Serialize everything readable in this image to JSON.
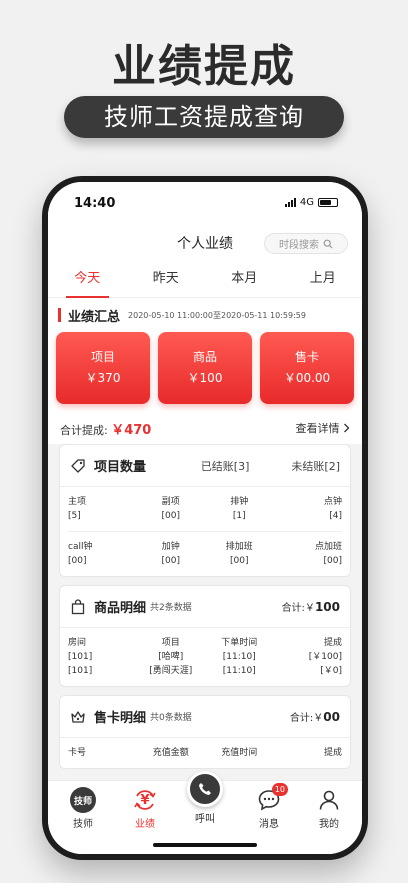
{
  "promo": {
    "title": "业绩提成",
    "subtitle": "技师工资提成查询"
  },
  "status": {
    "time": "14:40",
    "network": "4G"
  },
  "nav": {
    "title": "个人业绩",
    "search_label": "时段搜索"
  },
  "tabs": [
    {
      "label": "今天",
      "active": true
    },
    {
      "label": "昨天",
      "active": false
    },
    {
      "label": "本月",
      "active": false
    },
    {
      "label": "上月",
      "active": false
    }
  ],
  "summary": {
    "title": "业绩汇总",
    "range": "2020-05-10 11:00:00至2020-05-11 10:59:59",
    "cards": [
      {
        "label": "项目",
        "value": "￥370"
      },
      {
        "label": "商品",
        "value": "￥100"
      },
      {
        "label": "售卡",
        "value": "￥00.00"
      }
    ],
    "total_label": "合计提成:",
    "total_value": "￥470",
    "detail_link": "查看详情"
  },
  "project_panel": {
    "title": "项目数量",
    "settled": "已结账[3]",
    "unsettled": "未结账[2]",
    "row1": {
      "headers": [
        "主项",
        "副项",
        "排钟",
        "点钟"
      ],
      "values": [
        "[5]",
        "[00]",
        "[1]",
        "[4]"
      ]
    },
    "row2": {
      "headers": [
        "call钟",
        "加钟",
        "排加班",
        "点加班"
      ],
      "values": [
        "[00]",
        "[00]",
        "[00]",
        "[00]"
      ]
    }
  },
  "goods_panel": {
    "title": "商品明细",
    "sub": "共2条数据",
    "total_label": "合计:￥",
    "total_value": "100",
    "columns": [
      "房间",
      "项目",
      "下单时间",
      "提成"
    ],
    "rows": [
      [
        "[101]",
        "[哈啤]",
        "[11:10]",
        "[￥100]"
      ],
      [
        "[101]",
        "[勇闯天涯]",
        "[11:10]",
        "[￥0]"
      ]
    ]
  },
  "card_panel": {
    "title": "售卡明细",
    "sub": "共0条数据",
    "total_label": "合计:￥",
    "total_value": "00",
    "columns": [
      "卡号",
      "充值金额",
      "充值时间",
      "提成"
    ]
  },
  "tabbar": {
    "items": [
      {
        "label": "技师",
        "icon_text": "技师"
      },
      {
        "label": "业绩",
        "icon_text": "¥"
      },
      {
        "label": "呼叫"
      },
      {
        "label": "消息",
        "badge": "10"
      },
      {
        "label": "我的"
      }
    ]
  },
  "colors": {
    "accent": "#e8322f",
    "dark": "#3a3a3a"
  }
}
